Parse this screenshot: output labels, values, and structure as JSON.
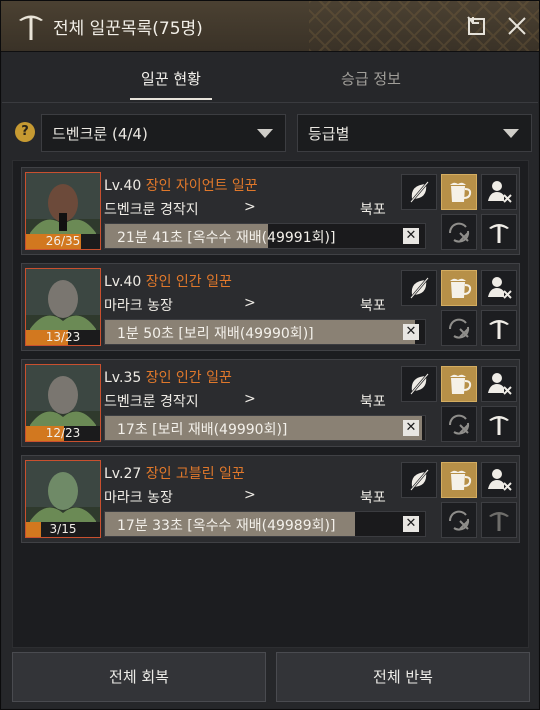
{
  "window": {
    "title": "전체 일꾼목록(75명)"
  },
  "tabs": [
    {
      "label": "일꾼 현황",
      "active": true
    },
    {
      "label": "승급 정보",
      "active": false
    }
  ],
  "filters": {
    "help_label": "?",
    "town": "드벤크룬 (4/4)",
    "sort": "등급별"
  },
  "workers": [
    {
      "level": "Lv.40",
      "name": "장인 자이언트 일꾼",
      "location": "드벤크룬 경작지",
      "arrow": ">",
      "destination": "북포",
      "stamina": "26/35",
      "stamina_ratio": 0.74,
      "task": "21분 41초 [옥수수 재배(49991회)]",
      "progress": 0.51,
      "skin": "#6c4a3a"
    },
    {
      "level": "Lv.40",
      "name": "장인 인간 일꾼",
      "location": "마라크 농장",
      "arrow": ">",
      "destination": "북포",
      "stamina": "13/23",
      "stamina_ratio": 0.57,
      "task": "1분 50초 [보리 재배(49990회)]",
      "progress": 0.97,
      "skin": "#7a7670"
    },
    {
      "level": "Lv.35",
      "name": "장인 인간 일꾼",
      "location": "드벤크룬 경작지",
      "arrow": ">",
      "destination": "북포",
      "stamina": "12/23",
      "stamina_ratio": 0.52,
      "task": "17초 [보리 재배(49990회)]",
      "progress": 0.99,
      "skin": "#7a7670"
    },
    {
      "level": "Lv.27",
      "name": "장인 고블린 일꾼",
      "location": "마라크 농장",
      "arrow": ">",
      "destination": "북포",
      "stamina": "3/15",
      "stamina_ratio": 0.2,
      "task": "17분 33초 [옥수수 재배(49989회)]",
      "progress": 0.78,
      "skin": "#6f8a67"
    }
  ],
  "footer": {
    "recover_all": "전체 회복",
    "repeat_all": "전체 반복"
  },
  "colors": {
    "accent_gold": "#b79048",
    "worker_name": "#e0782b",
    "stamina_fill": "#d2781f"
  }
}
